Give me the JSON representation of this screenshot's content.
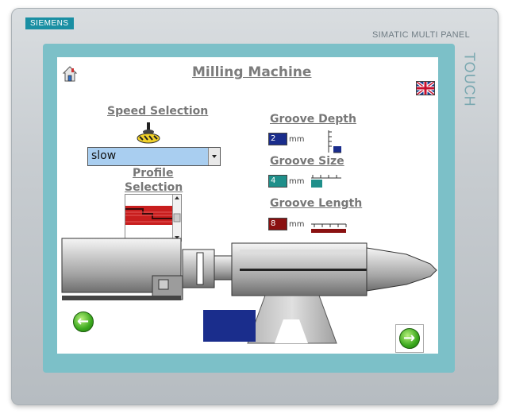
{
  "device": {
    "brand": "SIEMENS",
    "model": "SIMATIC MULTI PANEL",
    "side_label": "TOUCH"
  },
  "screen": {
    "title": "Milling Machine",
    "speed_selection": {
      "label": "Speed Selection",
      "selected": "slow"
    },
    "profile_selection": {
      "label_line1": "Profile",
      "label_line2": "Selection"
    },
    "groove_depth": {
      "label": "Groove Depth",
      "value": "2",
      "unit": "mm",
      "color": "#1a2d8c"
    },
    "groove_size": {
      "label": "Groove Size",
      "value": "4",
      "unit": "mm",
      "color": "#1f8f8a"
    },
    "groove_length": {
      "label": "Groove Length",
      "value": "8",
      "unit": "mm",
      "color": "#8a1111"
    },
    "icons": {
      "home": "home-icon",
      "language": "uk-flag-icon",
      "back": "arrow-left-icon",
      "next": "arrow-right-icon"
    },
    "colors": {
      "frame": "#7cc0c8",
      "brand_badge": "#1a8fa3",
      "dropdown_bg": "#a9cef0",
      "nav_green": "#3aa81d"
    }
  }
}
